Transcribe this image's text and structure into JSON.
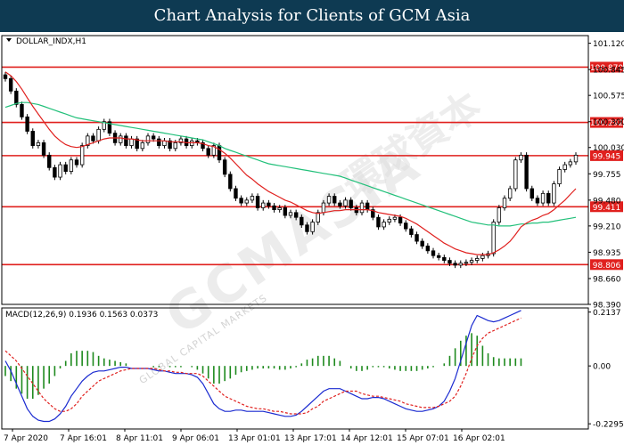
{
  "header": {
    "title": "Chart Analysis for Clients of GCM Asia"
  },
  "watermark": {
    "text": "GCMASIA",
    "chinese": "環球資本",
    "sub": "GLOBAL CAPITAL MARKETS"
  },
  "colors": {
    "header_bg": "#0e3a52",
    "candle": "#000000",
    "ema_fast": "#e0201e",
    "ema_slow": "#22c07a",
    "level_line": "#e0201e",
    "macd_hist": "#1e8a1e",
    "macd_line": "#1a2ad0",
    "signal_line": "#e0201e"
  },
  "chart_data": [
    {
      "type": "candlestick",
      "title": "DOLLAR_INDX,H1",
      "ylim": [
        98.39,
        101.2
      ],
      "y_ticks": [
        "101.120",
        "100.845",
        "100.575",
        "100.300",
        "100.030",
        "99.755",
        "99.480",
        "99.210",
        "98.935",
        "98.660",
        "98.390"
      ],
      "x_ticks": [
        "7 Apr 2020",
        "7 Apr 16:01",
        "8 Apr 11:01",
        "9 Apr 06:01",
        "13 Apr 01:01",
        "13 Apr 17:01",
        "14 Apr 12:01",
        "15 Apr 07:01",
        "16 Apr 02:01"
      ],
      "levels": [
        {
          "label": "100.870",
          "value": 100.87
        },
        {
          "label": "100.292",
          "value": 100.292
        },
        {
          "label": "99.945",
          "value": 99.945
        },
        {
          "label": "99.411",
          "value": 99.411
        },
        {
          "label": "98.806",
          "value": 98.806
        }
      ],
      "close": [
        100.75,
        100.62,
        100.48,
        100.35,
        100.2,
        100.05,
        100.08,
        99.95,
        99.82,
        99.72,
        99.85,
        99.78,
        99.9,
        99.85,
        100.05,
        100.15,
        100.1,
        100.22,
        100.3,
        100.18,
        100.08,
        100.15,
        100.05,
        100.12,
        100.02,
        100.08,
        100.15,
        100.12,
        100.05,
        100.1,
        100.02,
        100.08,
        100.12,
        100.05,
        100.1,
        100.08,
        100.02,
        99.95,
        100.05,
        99.9,
        99.75,
        99.6,
        99.5,
        99.45,
        99.48,
        99.52,
        99.4,
        99.45,
        99.42,
        99.38,
        99.4,
        99.32,
        99.35,
        99.3,
        99.22,
        99.15,
        99.25,
        99.35,
        99.45,
        99.52,
        99.45,
        99.42,
        99.48,
        99.4,
        99.35,
        99.45,
        99.38,
        99.3,
        99.2,
        99.25,
        99.28,
        99.3,
        99.24,
        99.18,
        99.12,
        99.05,
        99.0,
        98.95,
        98.9,
        98.88,
        98.85,
        98.82,
        98.8,
        98.82,
        98.83,
        98.85,
        98.87,
        98.9,
        98.92,
        99.25,
        99.4,
        99.5,
        99.6,
        99.9,
        99.95,
        99.6,
        99.5,
        99.45,
        99.55,
        99.45,
        99.65,
        99.8,
        99.85,
        99.88,
        99.95
      ],
      "ema_fast": [
        100.82,
        100.78,
        100.72,
        100.64,
        100.55,
        100.46,
        100.38,
        100.3,
        100.22,
        100.15,
        100.1,
        100.06,
        100.04,
        100.03,
        100.04,
        100.06,
        100.08,
        100.1,
        100.12,
        100.13,
        100.13,
        100.13,
        100.12,
        100.12,
        100.11,
        100.1,
        100.1,
        100.1,
        100.1,
        100.1,
        100.09,
        100.09,
        100.09,
        100.08,
        100.08,
        100.08,
        100.07,
        100.05,
        100.04,
        100.01,
        99.97,
        99.92,
        99.86,
        99.8,
        99.74,
        99.7,
        99.65,
        99.61,
        99.57,
        99.54,
        99.51,
        99.48,
        99.46,
        99.43,
        99.4,
        99.37,
        99.35,
        99.34,
        99.35,
        99.36,
        99.37,
        99.37,
        99.38,
        99.38,
        99.38,
        99.38,
        99.38,
        99.37,
        99.35,
        99.34,
        99.33,
        99.32,
        99.31,
        99.29,
        99.26,
        99.23,
        99.19,
        99.15,
        99.11,
        99.07,
        99.03,
        99.0,
        98.97,
        98.95,
        98.93,
        98.92,
        98.91,
        98.91,
        98.91,
        98.93,
        98.96,
        99.0,
        99.05,
        99.12,
        99.2,
        99.24,
        99.27,
        99.29,
        99.32,
        99.34,
        99.38,
        99.43,
        99.48,
        99.54,
        99.6
      ],
      "ema_slow": [
        100.45,
        100.47,
        100.49,
        100.5,
        100.5,
        100.49,
        100.48,
        100.46,
        100.44,
        100.42,
        100.4,
        100.38,
        100.36,
        100.34,
        100.33,
        100.32,
        100.31,
        100.3,
        100.29,
        100.28,
        100.27,
        100.26,
        100.25,
        100.24,
        100.23,
        100.22,
        100.21,
        100.2,
        100.19,
        100.18,
        100.17,
        100.16,
        100.15,
        100.14,
        100.13,
        100.12,
        100.11,
        100.09,
        100.07,
        100.05,
        100.02,
        100.0,
        99.98,
        99.96,
        99.94,
        99.92,
        99.9,
        99.88,
        99.86,
        99.85,
        99.84,
        99.83,
        99.82,
        99.81,
        99.8,
        99.79,
        99.78,
        99.77,
        99.76,
        99.75,
        99.74,
        99.73,
        99.71,
        99.69,
        99.67,
        99.65,
        99.63,
        99.61,
        99.59,
        99.57,
        99.55,
        99.53,
        99.51,
        99.49,
        99.47,
        99.45,
        99.43,
        99.41,
        99.39,
        99.37,
        99.35,
        99.33,
        99.31,
        99.29,
        99.27,
        99.25,
        99.24,
        99.23,
        99.22,
        99.22,
        99.21,
        99.21,
        99.21,
        99.22,
        99.23,
        99.23,
        99.24,
        99.24,
        99.25,
        99.25,
        99.26,
        99.27,
        99.28,
        99.29,
        99.3
      ]
    },
    {
      "type": "macd",
      "title": "MACD(12,26,9) 0.1936 0.1563 0.0373",
      "ylim": [
        -0.25,
        0.23
      ],
      "y_ticks": [
        {
          "label": "0.2137",
          "value": 0.2137
        },
        {
          "label": "0.00",
          "value": 0.0
        },
        {
          "label": "-0.2295",
          "value": -0.2295
        }
      ],
      "macd": [
        0.02,
        -0.02,
        -0.07,
        -0.12,
        -0.17,
        -0.2,
        -0.215,
        -0.22,
        -0.22,
        -0.21,
        -0.19,
        -0.16,
        -0.12,
        -0.09,
        -0.06,
        -0.04,
        -0.025,
        -0.02,
        -0.02,
        -0.015,
        -0.01,
        -0.005,
        -0.005,
        -0.01,
        -0.01,
        -0.01,
        -0.01,
        -0.015,
        -0.02,
        -0.02,
        -0.025,
        -0.03,
        -0.03,
        -0.03,
        -0.035,
        -0.045,
        -0.07,
        -0.11,
        -0.15,
        -0.17,
        -0.18,
        -0.18,
        -0.175,
        -0.175,
        -0.18,
        -0.18,
        -0.18,
        -0.18,
        -0.185,
        -0.19,
        -0.195,
        -0.2,
        -0.2,
        -0.195,
        -0.18,
        -0.16,
        -0.14,
        -0.12,
        -0.1,
        -0.09,
        -0.09,
        -0.09,
        -0.1,
        -0.11,
        -0.12,
        -0.13,
        -0.13,
        -0.125,
        -0.125,
        -0.13,
        -0.14,
        -0.15,
        -0.16,
        -0.17,
        -0.175,
        -0.18,
        -0.18,
        -0.175,
        -0.17,
        -0.16,
        -0.14,
        -0.1,
        -0.05,
        0.02,
        0.09,
        0.16,
        0.2,
        0.19,
        0.18,
        0.175,
        0.18,
        0.19,
        0.2,
        0.21,
        0.22
      ],
      "signal": [
        0.06,
        0.04,
        0.02,
        -0.01,
        -0.04,
        -0.07,
        -0.1,
        -0.13,
        -0.15,
        -0.17,
        -0.18,
        -0.18,
        -0.17,
        -0.15,
        -0.12,
        -0.1,
        -0.08,
        -0.06,
        -0.05,
        -0.04,
        -0.03,
        -0.02,
        -0.015,
        -0.01,
        -0.01,
        -0.01,
        -0.01,
        -0.01,
        -0.015,
        -0.02,
        -0.02,
        -0.025,
        -0.025,
        -0.03,
        -0.03,
        -0.03,
        -0.04,
        -0.06,
        -0.08,
        -0.1,
        -0.12,
        -0.13,
        -0.14,
        -0.15,
        -0.16,
        -0.165,
        -0.17,
        -0.17,
        -0.175,
        -0.18,
        -0.18,
        -0.185,
        -0.19,
        -0.19,
        -0.19,
        -0.185,
        -0.17,
        -0.16,
        -0.14,
        -0.13,
        -0.12,
        -0.11,
        -0.1,
        -0.1,
        -0.1,
        -0.11,
        -0.115,
        -0.12,
        -0.12,
        -0.125,
        -0.13,
        -0.135,
        -0.14,
        -0.15,
        -0.155,
        -0.16,
        -0.165,
        -0.165,
        -0.165,
        -0.16,
        -0.15,
        -0.14,
        -0.12,
        -0.08,
        -0.03,
        0.03,
        0.08,
        0.11,
        0.13,
        0.14,
        0.15,
        0.16,
        0.17,
        0.18,
        0.19
      ]
    }
  ]
}
